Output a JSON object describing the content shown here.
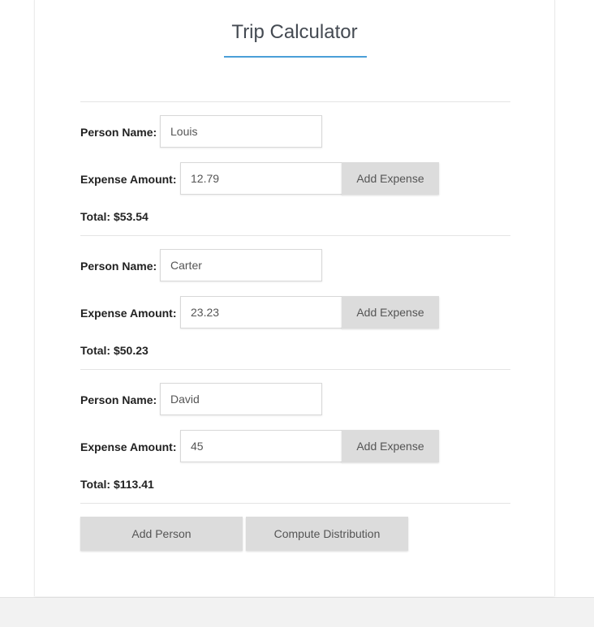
{
  "title": "Trip Calculator",
  "labels": {
    "person_name": "Person Name:",
    "expense_amount": "Expense Amount:"
  },
  "persons": [
    {
      "name": "Louis",
      "expense": "12.79",
      "add_expense_label": "Add Expense",
      "total": "Total: $53.54"
    },
    {
      "name": "Carter",
      "expense": "23.23",
      "add_expense_label": "Add Expense",
      "total": "Total: $50.23"
    },
    {
      "name": "David",
      "expense": "45",
      "add_expense_label": "Add Expense",
      "total": "Total: $113.41"
    }
  ],
  "actions": {
    "add_person": "Add Person",
    "compute_distribution": "Compute Distribution"
  },
  "colors": {
    "accent": "#4a9fd8",
    "button_bg": "#dcdcdc"
  }
}
